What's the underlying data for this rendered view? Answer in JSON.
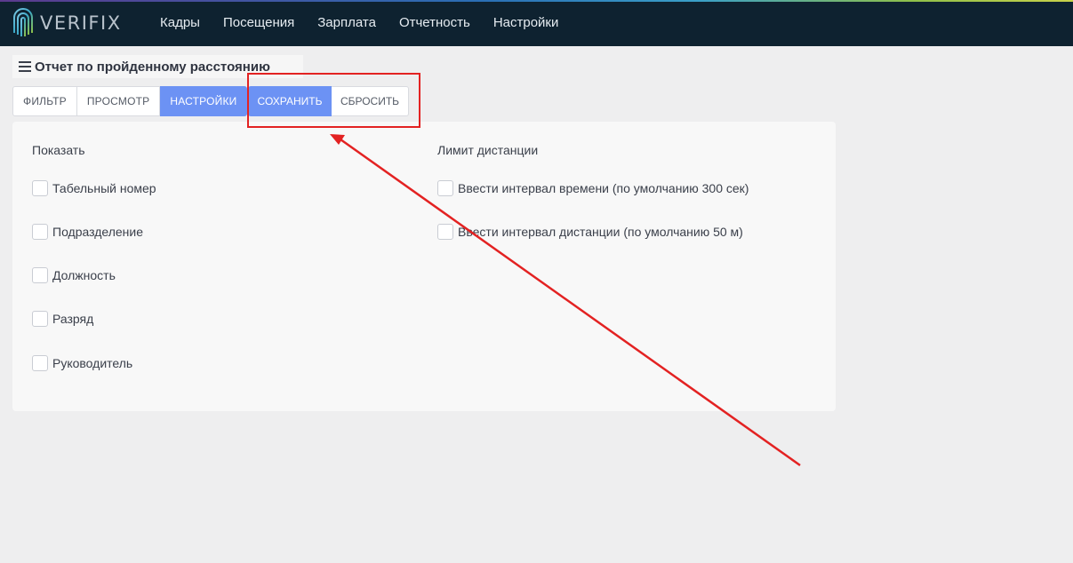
{
  "app": {
    "logo_text": "VERIFIX"
  },
  "nav": {
    "items": [
      "Кадры",
      "Посещения",
      "Зарплата",
      "Отчетность",
      "Настройки"
    ]
  },
  "page": {
    "title": "Отчет по пройденному расстоянию"
  },
  "toolbar": {
    "tabs": [
      "ФИЛЬТР",
      "ПРОСМОТР",
      "НАСТРОЙКИ"
    ],
    "active_tab": "НАСТРОЙКИ",
    "save_label": "СОХРАНИТЬ",
    "reset_label": "СБРОСИТЬ"
  },
  "settings": {
    "show": {
      "title": "Показать",
      "options": [
        "Табельный номер",
        "Подразделение",
        "Должность",
        "Разряд",
        "Руководитель"
      ]
    },
    "limit": {
      "title": "Лимит дистанции",
      "options": [
        "Ввести интервал времени (по умолчанию 300 сек)",
        "Ввести интервал дистанции (по умолчанию 50 м)"
      ]
    }
  },
  "colors": {
    "navbar_bg": "#0e2230",
    "accent": "#6c92f4",
    "annotation": "#e32222"
  }
}
